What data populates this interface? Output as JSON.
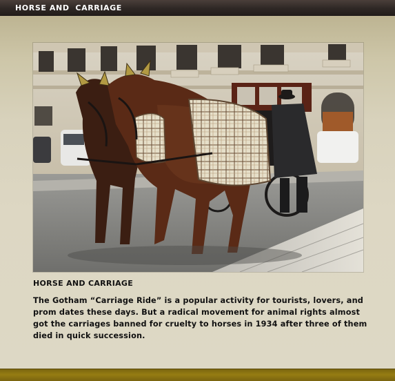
{
  "window": {
    "title": "HORSE AND  CARRIAGE"
  },
  "article": {
    "heading": "HORSE AND CARRIAGE",
    "body": "The Gotham “Carriage Ride” is a popular activity for tourists, lovers, and prom dates these days. But a radical movement for animal rights almost got the carriages banned for cruelty to horses in 1934 after three of them died in quick succession."
  },
  "colors": {
    "title_bar": "#2f2825",
    "content_background": "#ddd7c3",
    "footer_bar": "#957c12",
    "text": "#111111"
  }
}
